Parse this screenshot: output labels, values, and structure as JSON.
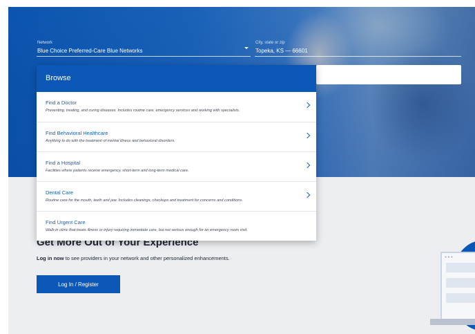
{
  "search": {
    "network_label": "Network",
    "network_value": "Blue Choice Preferred-Care Blue Networks",
    "location_label": "City, state or zip",
    "location_value": "Topeka, KS — 66601"
  },
  "browse": {
    "title": "Browse",
    "items": [
      {
        "title": "Find a Doctor",
        "description": "Preventing, treating, and curing diseases. Includes routine care, emergency services and working with specialists."
      },
      {
        "title": "Find Behavioral Healthcare",
        "description": "Anything to do with the treatment of mental illness and behavioral disorders."
      },
      {
        "title": "Find a Hospital",
        "description": "Facilities where patients receive emergency, short-term and long-term medical care."
      },
      {
        "title": "Dental Care",
        "description": "Routine care for the mouth, teeth and jaw. Includes cleanings, checkups and treatment for concerns and conditions."
      },
      {
        "title": "Find Urgent Care",
        "description": "Walk-in clinic that treats illness or injury requiring immediate care, but not serious enough for an emergency room visit."
      }
    ]
  },
  "experience": {
    "title": "Get More Out of Your Experience",
    "login_link": "Log in now",
    "login_text": " to see providers in your network and other personalized enhancements.",
    "button_label": "Log In / Register"
  },
  "colors": {
    "brand_blue": "#0a57b6",
    "link_blue": "#1460b4"
  },
  "icons": {
    "chevron": "chevron-right-icon",
    "select": "caret-down-icon"
  }
}
